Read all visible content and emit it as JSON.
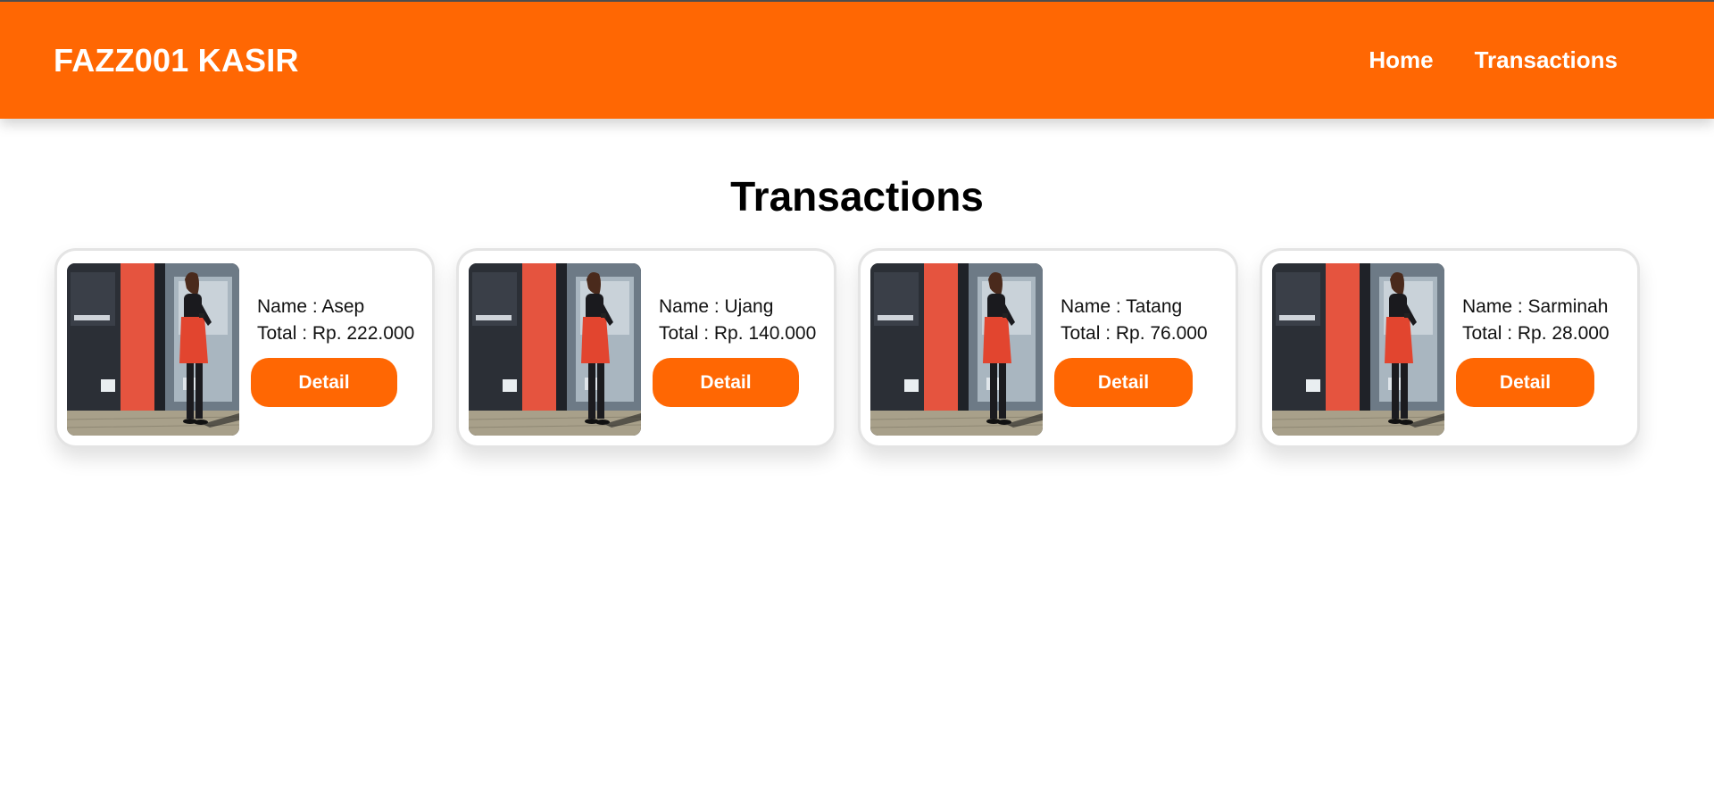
{
  "navbar": {
    "brand": "FAZZ001 KASIR",
    "links": [
      {
        "label": "Home"
      },
      {
        "label": "Transactions"
      }
    ],
    "accent_color": "#ff6703"
  },
  "page": {
    "title": "Transactions"
  },
  "transactions": [
    {
      "name": "Name : Asep",
      "total": "Total : Rp. 222.000",
      "button": "Detail"
    },
    {
      "name": "Name : Ujang",
      "total": "Total : Rp. 140.000",
      "button": "Detail"
    },
    {
      "name": "Name : Tatang",
      "total": "Total : Rp. 76.000",
      "button": "Detail"
    },
    {
      "name": "Name : Sarminah",
      "total": "Total : Rp. 28.000",
      "button": "Detail"
    }
  ]
}
